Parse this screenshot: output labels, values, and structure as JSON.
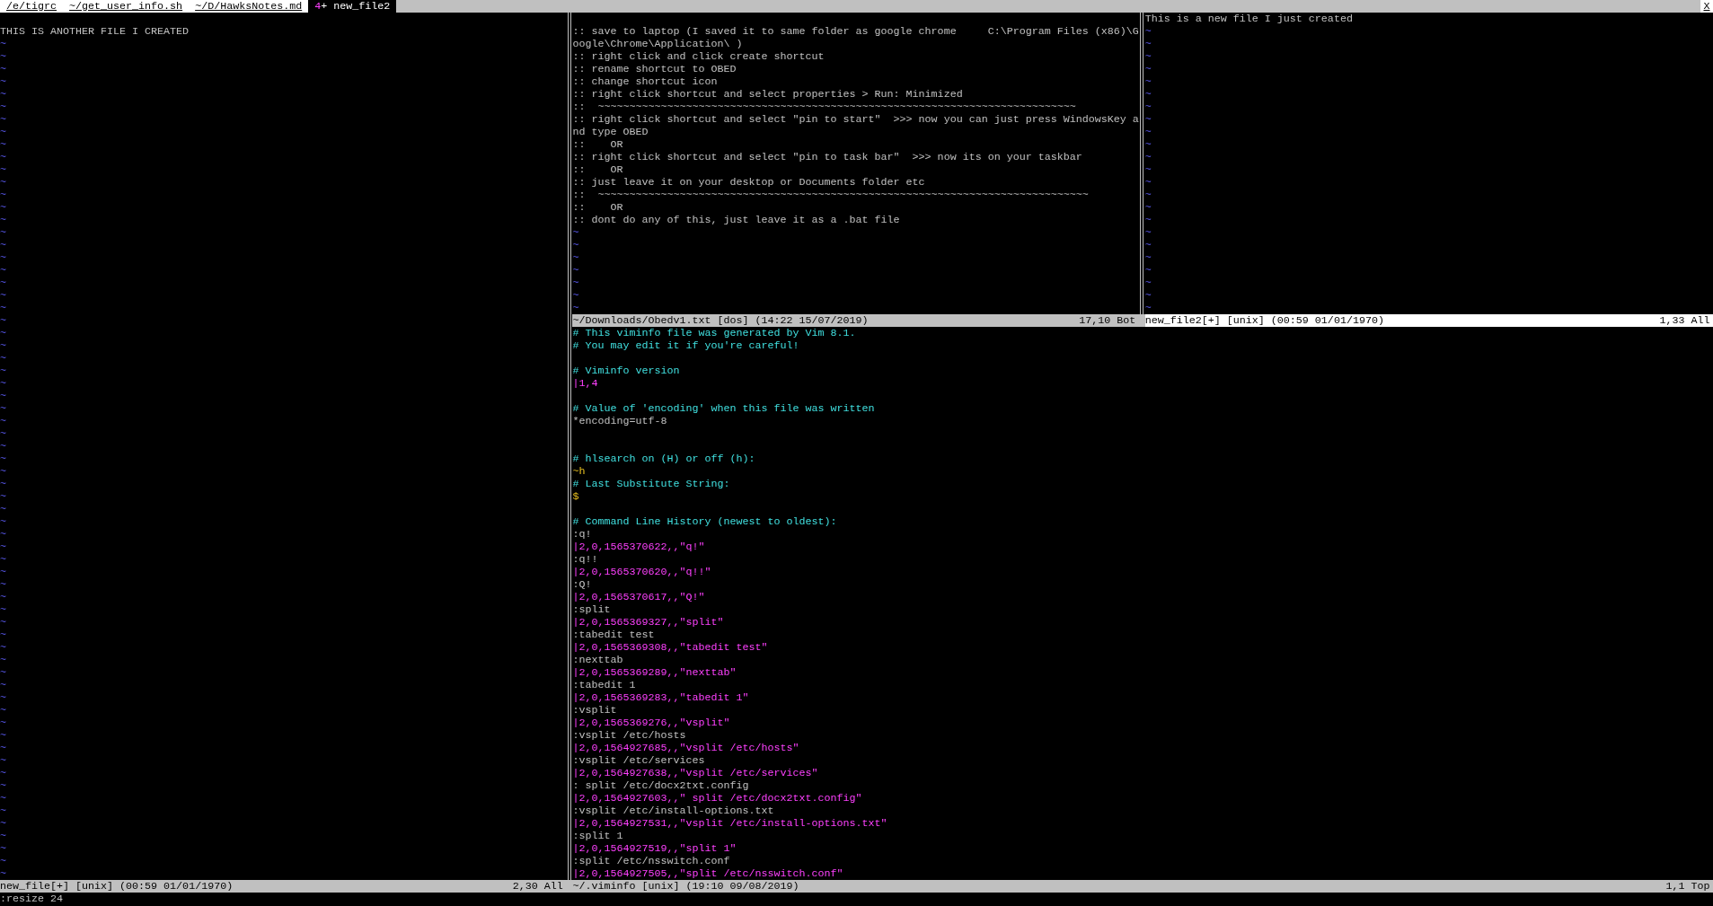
{
  "tabline": {
    "tabs": [
      {
        "label": "/e/tigrc",
        "selected": false
      },
      {
        "label": "~/get_user_info.sh",
        "selected": false
      },
      {
        "label": "~/D/HawksNotes.md",
        "selected": false
      },
      {
        "window_count": "4",
        "modified_mark": "+",
        "label": "new_file2",
        "selected": true
      }
    ],
    "close": "X"
  },
  "windows": [
    {
      "lines": [
        {
          "kind": "blank"
        },
        {
          "kind": "text",
          "text": "THIS IS ANOTHER FILE I CREATED"
        },
        {
          "kind": "filler",
          "text": "~"
        },
        {
          "kind": "filler",
          "text": "~"
        },
        {
          "kind": "filler",
          "text": "~"
        },
        {
          "kind": "filler",
          "text": "~"
        },
        {
          "kind": "filler",
          "text": "~"
        },
        {
          "kind": "filler",
          "text": "~"
        },
        {
          "kind": "filler",
          "text": "~"
        },
        {
          "kind": "filler",
          "text": "~"
        },
        {
          "kind": "filler",
          "text": "~"
        },
        {
          "kind": "filler",
          "text": "~"
        },
        {
          "kind": "filler",
          "text": "~"
        },
        {
          "kind": "filler",
          "text": "~"
        },
        {
          "kind": "filler",
          "text": "~"
        },
        {
          "kind": "filler",
          "text": "~"
        },
        {
          "kind": "filler",
          "text": "~"
        },
        {
          "kind": "filler",
          "text": "~"
        },
        {
          "kind": "filler",
          "text": "~"
        },
        {
          "kind": "filler",
          "text": "~"
        },
        {
          "kind": "filler",
          "text": "~"
        },
        {
          "kind": "filler",
          "text": "~"
        },
        {
          "kind": "filler",
          "text": "~"
        },
        {
          "kind": "filler",
          "text": "~"
        },
        {
          "kind": "filler",
          "text": "~"
        },
        {
          "kind": "filler",
          "text": "~"
        },
        {
          "kind": "filler",
          "text": "~"
        },
        {
          "kind": "filler",
          "text": "~"
        },
        {
          "kind": "filler",
          "text": "~"
        },
        {
          "kind": "filler",
          "text": "~"
        },
        {
          "kind": "filler",
          "text": "~"
        },
        {
          "kind": "filler",
          "text": "~"
        },
        {
          "kind": "filler",
          "text": "~"
        },
        {
          "kind": "filler",
          "text": "~"
        },
        {
          "kind": "filler",
          "text": "~"
        },
        {
          "kind": "filler",
          "text": "~"
        },
        {
          "kind": "filler",
          "text": "~"
        },
        {
          "kind": "filler",
          "text": "~"
        },
        {
          "kind": "filler",
          "text": "~"
        },
        {
          "kind": "filler",
          "text": "~"
        },
        {
          "kind": "filler",
          "text": "~"
        },
        {
          "kind": "filler",
          "text": "~"
        },
        {
          "kind": "filler",
          "text": "~"
        },
        {
          "kind": "filler",
          "text": "~"
        },
        {
          "kind": "filler",
          "text": "~"
        },
        {
          "kind": "filler",
          "text": "~"
        },
        {
          "kind": "filler",
          "text": "~"
        },
        {
          "kind": "filler",
          "text": "~"
        },
        {
          "kind": "filler",
          "text": "~"
        },
        {
          "kind": "filler",
          "text": "~"
        },
        {
          "kind": "filler",
          "text": "~"
        },
        {
          "kind": "filler",
          "text": "~"
        },
        {
          "kind": "filler",
          "text": "~"
        },
        {
          "kind": "filler",
          "text": "~"
        },
        {
          "kind": "filler",
          "text": "~"
        },
        {
          "kind": "filler",
          "text": "~"
        },
        {
          "kind": "filler",
          "text": "~"
        },
        {
          "kind": "filler",
          "text": "~"
        },
        {
          "kind": "filler",
          "text": "~"
        },
        {
          "kind": "filler",
          "text": "~"
        },
        {
          "kind": "filler",
          "text": "~"
        },
        {
          "kind": "filler",
          "text": "~"
        },
        {
          "kind": "filler",
          "text": "~"
        },
        {
          "kind": "filler",
          "text": "~"
        },
        {
          "kind": "filler",
          "text": "~"
        },
        {
          "kind": "filler",
          "text": "~"
        },
        {
          "kind": "filler",
          "text": "~"
        },
        {
          "kind": "filler",
          "text": "~"
        },
        {
          "kind": "filler",
          "text": "~"
        }
      ],
      "status": {
        "file": "new_file[+] [unix] (00:59 01/01/1970)",
        "position": "2,30 All",
        "active": false
      }
    },
    {
      "lines": [
        {
          "kind": "blank"
        },
        {
          "kind": "text",
          "text": ":: save to laptop (I saved it to same folder as google chrome     C:\\Program Files (x86)\\G"
        },
        {
          "kind": "text",
          "text": "oogle\\Chrome\\Application\\ )"
        },
        {
          "kind": "text",
          "text": ":: right click and click create shortcut"
        },
        {
          "kind": "text",
          "text": ":: rename shortcut to OBED"
        },
        {
          "kind": "text",
          "text": ":: change shortcut icon"
        },
        {
          "kind": "text",
          "text": ":: right click shortcut and select properties > Run: Minimized"
        },
        {
          "kind": "text",
          "text": "::  ~~~~~~~~~~~~~~~~~~~~~~~~~~~~~~~~~~~~~~~~~~~~~~~~~~~~~~~~~~~~~~~~~~~~~~~~~~~~"
        },
        {
          "kind": "text",
          "text": ":: right click shortcut and select \"pin to start\"  >>> now you can just press WindowsKey a"
        },
        {
          "kind": "text",
          "text": "nd type OBED"
        },
        {
          "kind": "text",
          "text": "::    OR"
        },
        {
          "kind": "text",
          "text": ":: right click shortcut and select \"pin to task bar\"  >>> now its on your taskbar"
        },
        {
          "kind": "text",
          "text": "::    OR"
        },
        {
          "kind": "text",
          "text": ":: just leave it on your desktop or Documents folder etc"
        },
        {
          "kind": "text",
          "text": "::  ~~~~~~~~~~~~~~~~~~~~~~~~~~~~~~~~~~~~~~~~~~~~~~~~~~~~~~~~~~~~~~~~~~~~~~~~~~~~~~"
        },
        {
          "kind": "text",
          "text": "::    OR"
        },
        {
          "kind": "text",
          "text": ":: dont do any of this, just leave it as a .bat file"
        },
        {
          "kind": "filler",
          "text": "~"
        },
        {
          "kind": "filler",
          "text": "~"
        },
        {
          "kind": "filler",
          "text": "~"
        },
        {
          "kind": "filler",
          "text": "~"
        },
        {
          "kind": "filler",
          "text": "~"
        },
        {
          "kind": "filler",
          "text": "~"
        },
        {
          "kind": "filler",
          "text": "~"
        }
      ],
      "status": {
        "file": "~/Downloads/Obedv1.txt [dos] (14:22 15/07/2019)",
        "position": "17,10 Bot",
        "active": false
      }
    },
    {
      "lines": [
        {
          "kind": "text",
          "text": "This is a new file I just created"
        },
        {
          "kind": "filler",
          "text": "~"
        },
        {
          "kind": "filler",
          "text": "~"
        },
        {
          "kind": "filler",
          "text": "~"
        },
        {
          "kind": "filler",
          "text": "~"
        },
        {
          "kind": "filler",
          "text": "~"
        },
        {
          "kind": "filler",
          "text": "~"
        },
        {
          "kind": "filler",
          "text": "~"
        },
        {
          "kind": "filler",
          "text": "~"
        },
        {
          "kind": "filler",
          "text": "~"
        },
        {
          "kind": "filler",
          "text": "~"
        },
        {
          "kind": "filler",
          "text": "~"
        },
        {
          "kind": "filler",
          "text": "~"
        },
        {
          "kind": "filler",
          "text": "~"
        },
        {
          "kind": "filler",
          "text": "~"
        },
        {
          "kind": "filler",
          "text": "~"
        },
        {
          "kind": "filler",
          "text": "~"
        },
        {
          "kind": "filler",
          "text": "~"
        },
        {
          "kind": "filler",
          "text": "~"
        },
        {
          "kind": "filler",
          "text": "~"
        },
        {
          "kind": "filler",
          "text": "~"
        },
        {
          "kind": "filler",
          "text": "~"
        },
        {
          "kind": "filler",
          "text": "~"
        },
        {
          "kind": "filler",
          "text": "~"
        }
      ],
      "status": {
        "file": "new_file2[+] [unix] (00:59 01/01/1970)",
        "position": "1,33 All",
        "active": true
      }
    },
    {
      "lines": [
        {
          "kind": "comment",
          "text": "# This viminfo file was generated by Vim 8.1."
        },
        {
          "kind": "comment",
          "text": "# You may edit it if you're careful!"
        },
        {
          "kind": "blank"
        },
        {
          "kind": "comment",
          "text": "# Viminfo version"
        },
        {
          "kind": "entry",
          "text": "|1,4"
        },
        {
          "kind": "blank"
        },
        {
          "kind": "comment",
          "text": "# Value of 'encoding' when this file was written"
        },
        {
          "kind": "text",
          "text": "*encoding=utf-8"
        },
        {
          "kind": "blank"
        },
        {
          "kind": "blank"
        },
        {
          "kind": "comment",
          "text": "# hlsearch on (H) or off (h):"
        },
        {
          "kind": "register",
          "text": "~h"
        },
        {
          "kind": "comment",
          "text": "# Last Substitute String:"
        },
        {
          "kind": "register",
          "text": "$"
        },
        {
          "kind": "blank"
        },
        {
          "kind": "comment",
          "text": "# Command Line History (newest to oldest):"
        },
        {
          "kind": "text",
          "text": ":q!"
        },
        {
          "kind": "entry",
          "text": "|2,0,1565370622,,\"q!\""
        },
        {
          "kind": "text",
          "text": ":q!!"
        },
        {
          "kind": "entry",
          "text": "|2,0,1565370620,,\"q!!\""
        },
        {
          "kind": "text",
          "text": ":Q!"
        },
        {
          "kind": "entry",
          "text": "|2,0,1565370617,,\"Q!\""
        },
        {
          "kind": "text",
          "text": ":split"
        },
        {
          "kind": "entry",
          "text": "|2,0,1565369327,,\"split\""
        },
        {
          "kind": "text",
          "text": ":tabedit test"
        },
        {
          "kind": "entry",
          "text": "|2,0,1565369308,,\"tabedit test\""
        },
        {
          "kind": "text",
          "text": ":nexttab"
        },
        {
          "kind": "entry",
          "text": "|2,0,1565369289,,\"nexttab\""
        },
        {
          "kind": "text",
          "text": ":tabedit 1"
        },
        {
          "kind": "entry",
          "text": "|2,0,1565369283,,\"tabedit 1\""
        },
        {
          "kind": "text",
          "text": ":vsplit"
        },
        {
          "kind": "entry",
          "text": "|2,0,1565369276,,\"vsplit\""
        },
        {
          "kind": "text",
          "text": ":vsplit /etc/hosts"
        },
        {
          "kind": "entry",
          "text": "|2,0,1564927685,,\"vsplit /etc/hosts\""
        },
        {
          "kind": "text",
          "text": ":vsplit /etc/services"
        },
        {
          "kind": "entry",
          "text": "|2,0,1564927638,,\"vsplit /etc/services\""
        },
        {
          "kind": "text",
          "text": ": split /etc/docx2txt.config"
        },
        {
          "kind": "entry",
          "text": "|2,0,1564927603,,\" split /etc/docx2txt.config\""
        },
        {
          "kind": "text",
          "text": ":vsplit /etc/install-options.txt"
        },
        {
          "kind": "entry",
          "text": "|2,0,1564927531,,\"vsplit /etc/install-options.txt\""
        },
        {
          "kind": "text",
          "text": ":split 1"
        },
        {
          "kind": "entry",
          "text": "|2,0,1564927519,,\"split 1\""
        },
        {
          "kind": "text",
          "text": ":split /etc/nsswitch.conf"
        },
        {
          "kind": "entry",
          "text": "|2,0,1564927505,,\"split /etc/nsswitch.conf\""
        }
      ],
      "status": {
        "file": "~/.viminfo [unix] (19:10 09/08/2019)",
        "position": "1,1 Top",
        "active": false
      }
    }
  ],
  "command_line": ":resize 24"
}
